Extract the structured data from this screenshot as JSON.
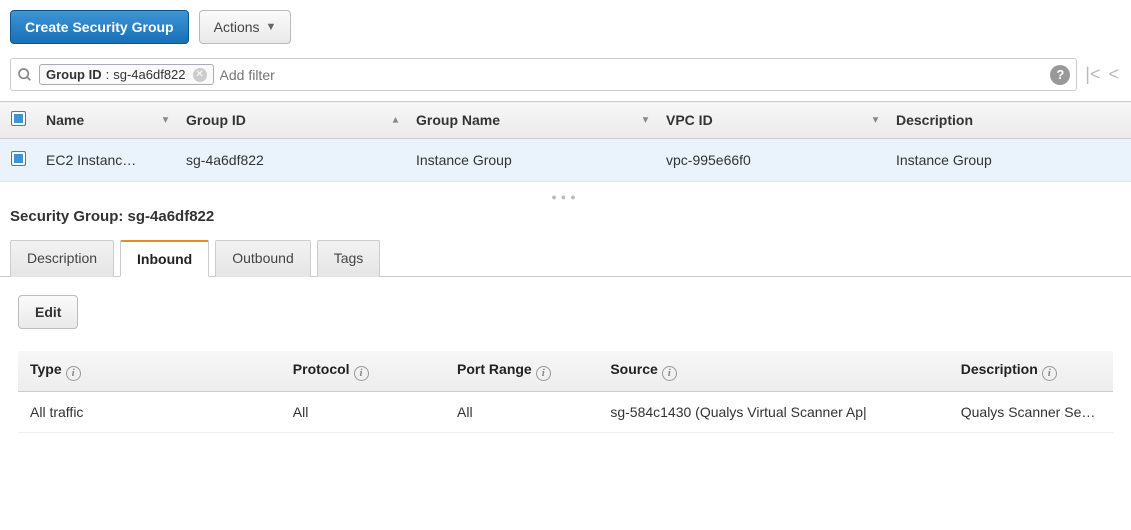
{
  "toolbar": {
    "create_label": "Create Security Group",
    "actions_label": "Actions"
  },
  "filter": {
    "chip_key": "Group ID",
    "chip_value": "sg-4a6df822",
    "placeholder": "Add filter"
  },
  "table": {
    "headers": {
      "name": "Name",
      "group_id": "Group ID",
      "group_name": "Group Name",
      "vpc_id": "VPC ID",
      "description": "Description"
    },
    "rows": [
      {
        "name": "EC2 Instanc…",
        "group_id": "sg-4a6df822",
        "group_name": "Instance Group",
        "vpc_id": "vpc-995e66f0",
        "description": "Instance Group"
      }
    ]
  },
  "detail": {
    "title_prefix": "Security Group:",
    "title_value": "sg-4a6df822",
    "tabs": {
      "description": "Description",
      "inbound": "Inbound",
      "outbound": "Outbound",
      "tags": "Tags"
    },
    "edit_label": "Edit",
    "rules": {
      "headers": {
        "type": "Type",
        "protocol": "Protocol",
        "port_range": "Port Range",
        "source": "Source",
        "description": "Description"
      },
      "rows": [
        {
          "type": "All traffic",
          "protocol": "All",
          "port_range": "All",
          "source": "sg-584c1430 (Qualys Virtual Scanner Ap|",
          "description": "Qualys Scanner Sec…"
        }
      ]
    }
  }
}
